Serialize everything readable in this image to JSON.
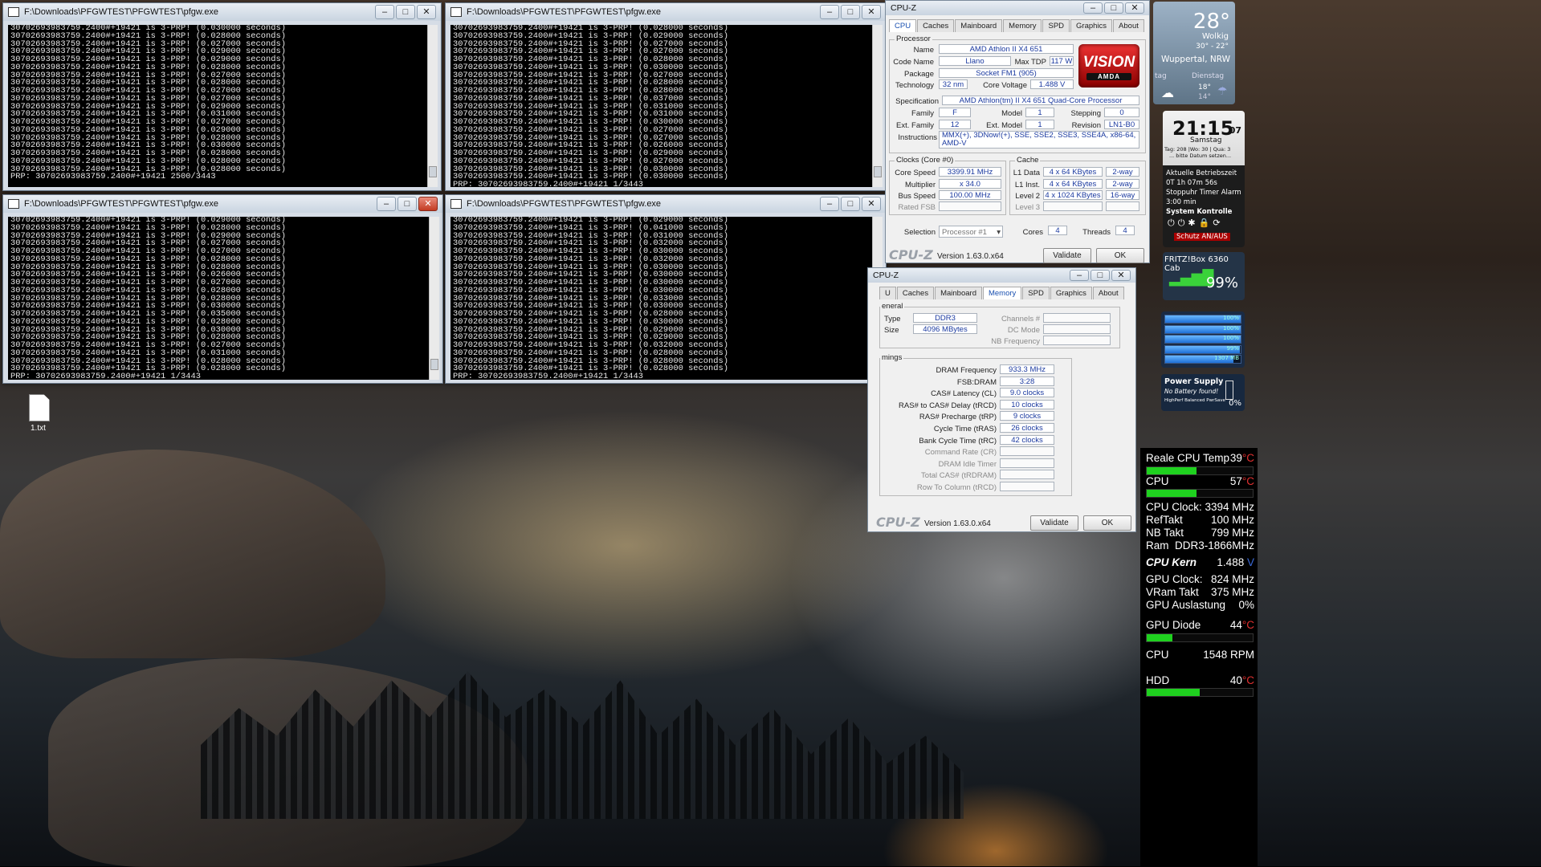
{
  "desktop": {
    "file_icon_label": "1.txt"
  },
  "pfgw_windows": [
    {
      "title": "F:\\Downloads\\PFGWTEST\\PFGWTEST\\pfgw.exe",
      "lines": [
        "30702693983759.2400#+19421 is 3-PRP! (0.030000 seconds)",
        "30702693983759.2400#+19421 is 3-PRP! (0.028000 seconds)",
        "30702693983759.2400#+19421 is 3-PRP! (0.027000 seconds)",
        "30702693983759.2400#+19421 is 3-PRP! (0.029000 seconds)",
        "30702693983759.2400#+19421 is 3-PRP! (0.029000 seconds)",
        "30702693983759.2400#+19421 is 3-PRP! (0.028000 seconds)",
        "30702693983759.2400#+19421 is 3-PRP! (0.027000 seconds)",
        "30702693983759.2400#+19421 is 3-PRP! (0.028000 seconds)",
        "30702693983759.2400#+19421 is 3-PRP! (0.027000 seconds)",
        "30702693983759.2400#+19421 is 3-PRP! (0.027000 seconds)",
        "30702693983759.2400#+19421 is 3-PRP! (0.029000 seconds)",
        "30702693983759.2400#+19421 is 3-PRP! (0.031000 seconds)",
        "30702693983759.2400#+19421 is 3-PRP! (0.027000 seconds)",
        "30702693983759.2400#+19421 is 3-PRP! (0.029000 seconds)",
        "30702693983759.2400#+19421 is 3-PRP! (0.028000 seconds)",
        "30702693983759.2400#+19421 is 3-PRP! (0.030000 seconds)",
        "30702693983759.2400#+19421 is 3-PRP! (0.028000 seconds)",
        "30702693983759.2400#+19421 is 3-PRP! (0.028000 seconds)",
        "30702693983759.2400#+19421 is 3-PRP! (0.028000 seconds)",
        "PRP: 30702693983759.2400#+19421 2500/3443"
      ]
    },
    {
      "title": "F:\\Downloads\\PFGWTEST\\PFGWTEST\\pfgw.exe",
      "lines": [
        "30702693983759.2400#+19421 is 3-PRP! (0.028000 seconds)",
        "30702693983759.2400#+19421 is 3-PRP! (0.029000 seconds)",
        "30702693983759.2400#+19421 is 3-PRP! (0.027000 seconds)",
        "30702693983759.2400#+19421 is 3-PRP! (0.027000 seconds)",
        "30702693983759.2400#+19421 is 3-PRP! (0.028000 seconds)",
        "30702693983759.2400#+19421 is 3-PRP! (0.030000 seconds)",
        "30702693983759.2400#+19421 is 3-PRP! (0.027000 seconds)",
        "30702693983759.2400#+19421 is 3-PRP! (0.028000 seconds)",
        "30702693983759.2400#+19421 is 3-PRP! (0.028000 seconds)",
        "30702693983759.2400#+19421 is 3-PRP! (0.037000 seconds)",
        "30702693983759.2400#+19421 is 3-PRP! (0.031000 seconds)",
        "30702693983759.2400#+19421 is 3-PRP! (0.031000 seconds)",
        "30702693983759.2400#+19421 is 3-PRP! (0.030000 seconds)",
        "30702693983759.2400#+19421 is 3-PRP! (0.027000 seconds)",
        "30702693983759.2400#+19421 is 3-PRP! (0.027000 seconds)",
        "30702693983759.2400#+19421 is 3-PRP! (0.026000 seconds)",
        "30702693983759.2400#+19421 is 3-PRP! (0.029000 seconds)",
        "30702693983759.2400#+19421 is 3-PRP! (0.027000 seconds)",
        "30702693983759.2400#+19421 is 3-PRP! (0.030000 seconds)",
        "30702693983759.2400#+19421 is 3-PRP! (0.030000 seconds)",
        "PRP: 30702693983759.2400#+19421 1/3443"
      ]
    },
    {
      "title": "F:\\Downloads\\PFGWTEST\\PFGWTEST\\pfgw.exe",
      "lines": [
        "30702693983759.2400#+19421 is 3-PRP! (0.029000 seconds)",
        "30702693983759.2400#+19421 is 3-PRP! (0.028000 seconds)",
        "30702693983759.2400#+19421 is 3-PRP! (0.029000 seconds)",
        "30702693983759.2400#+19421 is 3-PRP! (0.027000 seconds)",
        "30702693983759.2400#+19421 is 3-PRP! (0.027000 seconds)",
        "30702693983759.2400#+19421 is 3-PRP! (0.028000 seconds)",
        "30702693983759.2400#+19421 is 3-PRP! (0.028000 seconds)",
        "30702693983759.2400#+19421 is 3-PRP! (0.026000 seconds)",
        "30702693983759.2400#+19421 is 3-PRP! (0.027000 seconds)",
        "30702693983759.2400#+19421 is 3-PRP! (0.028000 seconds)",
        "30702693983759.2400#+19421 is 3-PRP! (0.028000 seconds)",
        "30702693983759.2400#+19421 is 3-PRP! (0.030000 seconds)",
        "30702693983759.2400#+19421 is 3-PRP! (0.035000 seconds)",
        "30702693983759.2400#+19421 is 3-PRP! (0.028000 seconds)",
        "30702693983759.2400#+19421 is 3-PRP! (0.030000 seconds)",
        "30702693983759.2400#+19421 is 3-PRP! (0.028000 seconds)",
        "30702693983759.2400#+19421 is 3-PRP! (0.027000 seconds)",
        "30702693983759.2400#+19421 is 3-PRP! (0.031000 seconds)",
        "30702693983759.2400#+19421 is 3-PRP! (0.028000 seconds)",
        "30702693983759.2400#+19421 is 3-PRP! (0.028000 seconds)",
        "PRP: 30702693983759.2400#+19421 1/3443"
      ]
    },
    {
      "title": "F:\\Downloads\\PFGWTEST\\PFGWTEST\\pfgw.exe",
      "lines": [
        "30702693983759.2400#+19421 is 3-PRP! (0.029000 seconds)",
        "30702693983759.2400#+19421 is 3-PRP! (0.041000 seconds)",
        "30702693983759.2400#+19421 is 3-PRP! (0.031000 seconds)",
        "30702693983759.2400#+19421 is 3-PRP! (0.032000 seconds)",
        "30702693983759.2400#+19421 is 3-PRP! (0.030000 seconds)",
        "30702693983759.2400#+19421 is 3-PRP! (0.032000 seconds)",
        "30702693983759.2400#+19421 is 3-PRP! (0.030000 seconds)",
        "30702693983759.2400#+19421 is 3-PRP! (0.030000 seconds)",
        "30702693983759.2400#+19421 is 3-PRP! (0.030000 seconds)",
        "30702693983759.2400#+19421 is 3-PRP! (0.030000 seconds)",
        "30702693983759.2400#+19421 is 3-PRP! (0.033000 seconds)",
        "30702693983759.2400#+19421 is 3-PRP! (0.030000 seconds)",
        "30702693983759.2400#+19421 is 3-PRP! (0.028000 seconds)",
        "30702693983759.2400#+19421 is 3-PRP! (0.030000 seconds)",
        "30702693983759.2400#+19421 is 3-PRP! (0.029000 seconds)",
        "30702693983759.2400#+19421 is 3-PRP! (0.029000 seconds)",
        "30702693983759.2400#+19421 is 3-PRP! (0.032000 seconds)",
        "30702693983759.2400#+19421 is 3-PRP! (0.028000 seconds)",
        "30702693983759.2400#+19421 is 3-PRP! (0.028000 seconds)",
        "30702693983759.2400#+19421 is 3-PRP! (0.028000 seconds)",
        "PRP: 30702693983759.2400#+19421 1/3443"
      ]
    }
  ],
  "window_controls": {
    "minimize": "–",
    "maximize": "□",
    "close": "✕"
  },
  "cpuz_cpu": {
    "title": "CPU-Z",
    "tabs": [
      "CPU",
      "Caches",
      "Mainboard",
      "Memory",
      "SPD",
      "Graphics",
      "About"
    ],
    "active_tab": "CPU",
    "processor_label": "Processor",
    "name_label": "Name",
    "name": "AMD Athlon II X4 651",
    "codename_label": "Code Name",
    "codename": "Llano",
    "maxtdp_label": "Max TDP",
    "maxtdp": "117 W",
    "package_label": "Package",
    "package": "Socket FM1 (905)",
    "technology_label": "Technology",
    "technology": "32 nm",
    "voltage_label": "Core Voltage",
    "voltage": "1.488 V",
    "spec_label": "Specification",
    "spec": "AMD Athlon(tm) II X4 651 Quad-Core Processor",
    "family_label": "Family",
    "family": "F",
    "model_label": "Model",
    "model": "1",
    "stepping_label": "Stepping",
    "stepping": "0",
    "extfamily_label": "Ext. Family",
    "extfamily": "12",
    "extmodel_label": "Ext. Model",
    "extmodel": "1",
    "revision_label": "Revision",
    "revision": "LN1-B0",
    "instructions_label": "Instructions",
    "instructions": "MMX(+), 3DNow!(+), SSE, SSE2, SSE3, SSE4A, x86-64, AMD-V",
    "clocks_label": "Clocks (Core #0)",
    "corespeed_label": "Core Speed",
    "corespeed": "3399.91 MHz",
    "multiplier_label": "Multiplier",
    "multiplier": "x 34.0",
    "busspeed_label": "Bus Speed",
    "busspeed": "100.00 MHz",
    "ratedfsb_label": "Rated FSB",
    "cache_label": "Cache",
    "l1d_label": "L1 Data",
    "l1d": "4 x 64 KBytes",
    "l1d_way": "2-way",
    "l1i_label": "L1 Inst.",
    "l1i": "4 x 64 KBytes",
    "l1i_way": "2-way",
    "l2_label": "Level 2",
    "l2": "4 x 1024 KBytes",
    "l2_way": "16-way",
    "l3_label": "Level 3",
    "selection_label": "Selection",
    "selection": "Processor #1",
    "cores_label": "Cores",
    "cores": "4",
    "threads_label": "Threads",
    "threads": "4",
    "logo": "CPU-Z",
    "version": "Version 1.63.0.x64",
    "validate": "Validate",
    "ok": "OK",
    "badge_main": "VISION",
    "badge_sub": "AMDA"
  },
  "cpuz_mem": {
    "title": "CPU-Z",
    "tabs": [
      "U",
      "Caches",
      "Mainboard",
      "Memory",
      "SPD",
      "Graphics",
      "About"
    ],
    "active_tab": "Memory",
    "general_label": "eneral",
    "type_label": "Type",
    "type": "DDR3",
    "size_label": "Size",
    "size": "4096 MBytes",
    "channels_label": "Channels #",
    "dcmode_label": "DC Mode",
    "nbfreq_label": "NB Frequency",
    "timings_label": "mings",
    "timings": [
      {
        "label": "DRAM Frequency",
        "value": "933.3 MHz",
        "dim": false
      },
      {
        "label": "FSB:DRAM",
        "value": "3:28",
        "dim": false
      },
      {
        "label": "CAS# Latency (CL)",
        "value": "9.0 clocks",
        "dim": false
      },
      {
        "label": "RAS# to CAS# Delay (tRCD)",
        "value": "10 clocks",
        "dim": false
      },
      {
        "label": "RAS# Precharge (tRP)",
        "value": "9 clocks",
        "dim": false
      },
      {
        "label": "Cycle Time (tRAS)",
        "value": "26 clocks",
        "dim": false
      },
      {
        "label": "Bank Cycle Time (tRC)",
        "value": "42 clocks",
        "dim": false
      },
      {
        "label": "Command Rate (CR)",
        "value": "",
        "dim": true
      },
      {
        "label": "DRAM Idle Timer",
        "value": "",
        "dim": true
      },
      {
        "label": "Total CAS# (tRDRAM)",
        "value": "",
        "dim": true
      },
      {
        "label": "Row To Column (tRCD)",
        "value": "",
        "dim": true
      }
    ],
    "logo": "CPU-Z",
    "version": "Version 1.63.0.x64",
    "validate": "Validate",
    "ok": "OK"
  },
  "weather": {
    "temp": "28°",
    "condition": "Wolkig",
    "range": "30° - 22°",
    "city": "Wuppertal, NRW",
    "day1": "tag",
    "day2": "Dienstag",
    "day2_high": "18°",
    "day2_low": "14°"
  },
  "clock": {
    "time": "21:15",
    "seconds": "07",
    "day": "Samstag",
    "note_line1": "Tag: 208 |Wo: 30 | Qua: 3",
    "note_line2": "... bitte Datum setzen...",
    "uptime_label": "Aktuelle Betriebszeit",
    "uptime": "0T 1h 07m 56s",
    "stopwatch_label": "Stoppuhr Timer Alarm",
    "stopwatch": "3:00 min",
    "syscontrol_label": "System Kontrolle",
    "schutz": "Schutz AN/AUS"
  },
  "fritz": {
    "title": "FRITZ!Box 6360 Cab",
    "signal": "99%"
  },
  "meters": {
    "labels": [
      "100%",
      "100%",
      "100%",
      "99%",
      "1307 MB"
    ],
    "levels": [
      1.0,
      1.0,
      1.0,
      0.99,
      0.9
    ]
  },
  "power": {
    "title": "Power Supply",
    "line1": "No Battery found!",
    "line2": "HighPerf  Balanced  PwrSave",
    "percent": "0%"
  },
  "sidebar": {
    "realtemp_label": "Reale CPU Temp",
    "realtemp": "39",
    "realtemp_level": 0.47,
    "cpu_label": "CPU",
    "cpu": "57",
    "cpu_level": 0.47,
    "cpuclock_label": "CPU Clock:",
    "cpuclock": "3394 MHz",
    "reftakt_label": "RefTakt",
    "reftakt": "100 MHz",
    "nbtakt_label": "NB Takt",
    "nbtakt": "799 MHz",
    "ram_label": "Ram",
    "ram": "DDR3-1866MHz",
    "cpukern_label": "CPU Kern",
    "cpukern": "1.488",
    "cpukern_unit": "V",
    "gpuclock_label": "GPU Clock:",
    "gpuclock": "824 MHz",
    "vram_label": "VRam Takt",
    "vram": "375 MHz",
    "gpuload_label": "GPU Auslastung",
    "gpuload": "0%",
    "gpudiode_label": "GPU Diode",
    "gpudiode": "44",
    "gpudiode_level": 0.24,
    "fan_label": "CPU",
    "fan": "1548 RPM",
    "hdd_label": "HDD",
    "hdd": "40",
    "hdd_level": 0.5,
    "temp_unit": "°C"
  },
  "colors": {
    "accent_blue": "#1b3aa0",
    "bar_green": "#1fd11f",
    "temp_red": "#e03030"
  }
}
